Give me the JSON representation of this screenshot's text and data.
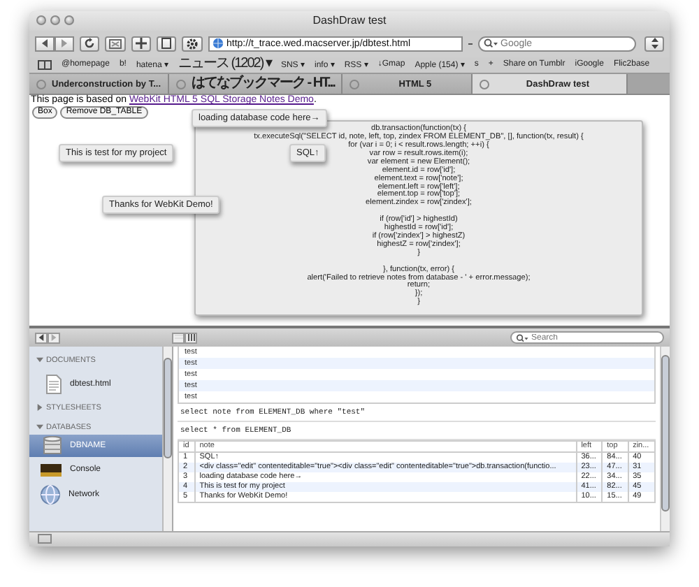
{
  "window": {
    "title": "DashDraw test"
  },
  "toolbar": {
    "url": "http://t_trace.wed.macserver.jp/dbtest.html",
    "search_placeholder": "Google"
  },
  "bookmarks": [
    {
      "label": "@homepage"
    },
    {
      "label": "b!"
    },
    {
      "label": "hatena ▾"
    },
    {
      "label": "ニュース (1202) ▾"
    },
    {
      "label": "SNS ▾"
    },
    {
      "label": "info ▾"
    },
    {
      "label": "RSS ▾"
    },
    {
      "label": "↓Gmap"
    },
    {
      "label": "Apple (154) ▾"
    },
    {
      "label": "s"
    },
    {
      "label": "+"
    },
    {
      "label": "Share on Tumblr"
    },
    {
      "label": "iGoogle"
    },
    {
      "label": "Flic2base"
    }
  ],
  "tabs": [
    {
      "label": "Underconstruction by T...",
      "selected": false
    },
    {
      "label": "はてなブックマーク - HT...",
      "selected": false
    },
    {
      "label": "HTML 5",
      "selected": false
    },
    {
      "label": "DashDraw test",
      "selected": true
    }
  ],
  "page": {
    "intro": "This page is based on ",
    "intro_link": "WebKit HTML 5 SQL Storage Notes Demo",
    "intro_end": ".",
    "buttons": [
      "Box",
      "Remove DB_TABLE"
    ],
    "code_note": "db.transaction(function(tx) {\ntx.executeSql(\"SELECT id, note, left, top, zindex FROM ELEMENT_DB\", [], function(tx, result) {\nfor (var i = 0; i < result.rows.length; ++i) {\nvar row = result.rows.item(i);\nvar element = new Element();\nelement.id = row['id'];\nelement.text = row['note'];\nelement.left = row['left'];\nelement.top = row['top'];\nelement.zindex = row['zindex'];\n\nif (row['id'] > highestId)\nhighestId = row['id'];\nif (row['zindex'] > highestZ)\nhighestZ = row['zindex'];\n}\n\n}, function(tx, error) {\nalert('Failed to retrieve notes from database - ' + error.message);\nreturn;\n});\n}",
    "notes": [
      "loading database code here→",
      "SQL↑",
      "This is test for my project",
      "Thanks for WebKit Demo!"
    ]
  },
  "inspector": {
    "search_placeholder": "Search",
    "sections": [
      {
        "label": "DOCUMENTS",
        "expanded": true,
        "items": [
          {
            "label": "dbtest.html",
            "kind": "document",
            "selected": false
          }
        ]
      },
      {
        "label": "STYLESHEETS",
        "expanded": false
      },
      {
        "label": "DATABASES",
        "expanded": true,
        "items": [
          {
            "label": "DBNAME",
            "kind": "database",
            "selected": true
          }
        ]
      }
    ],
    "tools": [
      {
        "label": "Console",
        "kind": "console"
      },
      {
        "label": "Network",
        "kind": "network"
      }
    ],
    "results": [
      "test",
      "test",
      "test",
      "test",
      "test"
    ],
    "queries": [
      "select note from ELEMENT_DB where \"test\"",
      "select * from ELEMENT_DB"
    ],
    "table": {
      "columns": [
        "id",
        "note",
        "left",
        "top",
        "zin..."
      ],
      "rows": [
        [
          "1",
          "SQL↑",
          "36...",
          "84...",
          "40"
        ],
        [
          "2",
          "<div class=\"edit\" contenteditable=\"true\"><div class=\"edit\" contenteditable=\"true\">db.transaction(functio...",
          "23...",
          "47...",
          "31"
        ],
        [
          "3",
          "loading database code here→",
          "22...",
          "34...",
          "35"
        ],
        [
          "4",
          "This is test for my project",
          "41...",
          "82...",
          "45"
        ],
        [
          "5",
          "Thanks for WebKit Demo!",
          "10...",
          "15...",
          "49"
        ]
      ]
    }
  }
}
